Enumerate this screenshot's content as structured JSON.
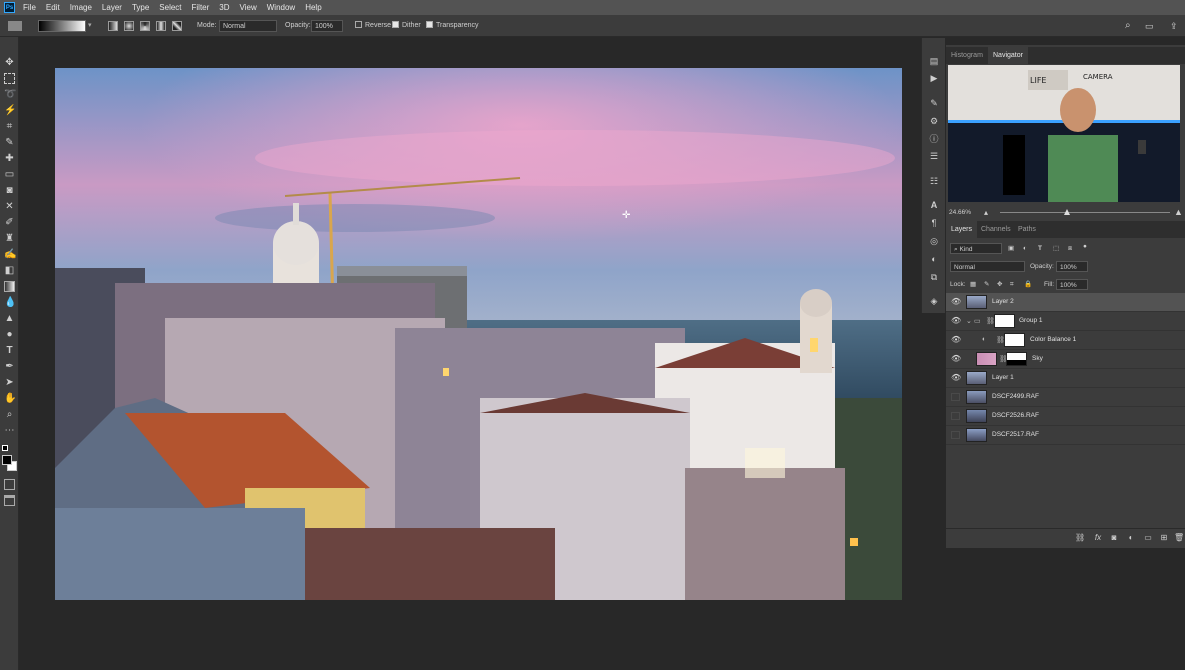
{
  "app": {
    "logo": "Ps"
  },
  "menu": [
    "File",
    "Edit",
    "Image",
    "Layer",
    "Type",
    "Select",
    "Filter",
    "3D",
    "View",
    "Window",
    "Help"
  ],
  "options": {
    "mode_label": "Mode:",
    "mode_value": "Normal",
    "opacity_label": "Opacity:",
    "opacity_value": "100%",
    "reverse_label": "Reverse",
    "reverse_checked": false,
    "dither_label": "Dither",
    "dither_checked": true,
    "transparency_label": "Transparency",
    "transparency_checked": true
  },
  "panel_tabs_top": [
    {
      "label": "Histogram",
      "active": false
    },
    {
      "label": "Navigator",
      "active": true
    }
  ],
  "navigator": {
    "zoom": "24.66%",
    "thumb_text_1": "LIFE",
    "thumb_text_2": "CAMERA"
  },
  "panel_tabs_layers": [
    {
      "label": "Layers",
      "active": true
    },
    {
      "label": "Channels",
      "active": false
    },
    {
      "label": "Paths",
      "active": false
    }
  ],
  "layers_controls": {
    "filter_kind": "Kind",
    "blend_mode": "Normal",
    "opacity_label": "Opacity:",
    "opacity_value": "100%",
    "lock_label": "Lock:",
    "fill_label": "Fill:",
    "fill_value": "100%"
  },
  "layers": [
    {
      "name": "Layer 2",
      "visible": true,
      "selected": true
    },
    {
      "name": "Group 1",
      "visible": true,
      "selected": false
    },
    {
      "name": "Color Balance 1",
      "visible": true,
      "selected": false
    },
    {
      "name": "Sky",
      "visible": true,
      "selected": false
    },
    {
      "name": "Layer 1",
      "visible": true,
      "selected": false
    },
    {
      "name": "DSCF2499.RAF",
      "visible": false,
      "selected": false
    },
    {
      "name": "DSCF2526.RAF",
      "visible": false,
      "selected": false
    },
    {
      "name": "DSCF2517.RAF",
      "visible": false,
      "selected": false
    }
  ],
  "colors": {
    "accent": "#31a8ff",
    "panel_bg": "#3c3c3c",
    "workspace_bg": "#282828",
    "selected_layer": "#535353"
  }
}
